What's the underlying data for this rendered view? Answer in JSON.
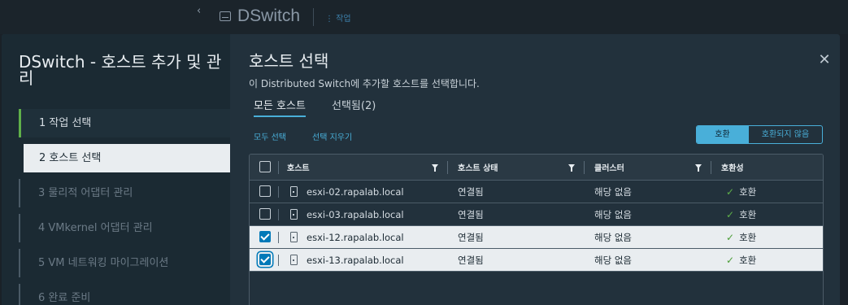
{
  "app": {
    "object_title": "DSwitch",
    "actions_label": "⋮ 작업",
    "collapse_glyph": "‹"
  },
  "wizard": {
    "title": "DSwitch - 호스트 추가 및 관리",
    "steps": [
      {
        "label": "1  작업 선택"
      },
      {
        "label": "2  호스트 선택"
      },
      {
        "label": "3  물리적 어댑터 관리"
      },
      {
        "label": "4  VMkernel 어댑터 관리"
      },
      {
        "label": "5  VM 네트워킹 마이그레이션"
      },
      {
        "label": "6  완료 준비"
      }
    ]
  },
  "page": {
    "title": "호스트 선택",
    "description": "이 Distributed Switch에 추가할 호스트를 선택합니다.",
    "close_glyph": "✕",
    "tabs": [
      {
        "label": "모든 호스트"
      },
      {
        "label": "선택됨(2)"
      }
    ],
    "select_all": "모두 선택",
    "clear_selection": "선택 지우기",
    "filter": {
      "compatible": "호환",
      "incompatible": "호환되지 않음"
    }
  },
  "grid": {
    "columns": [
      "호스트",
      "호스트 상태",
      "클러스터",
      "호환성"
    ],
    "rows": [
      {
        "host": "esxi-02.rapalab.local",
        "status": "연결됨",
        "cluster": "해당 없음",
        "compat": "호환",
        "selected": false
      },
      {
        "host": "esxi-03.rapalab.local",
        "status": "연결됨",
        "cluster": "해당 없음",
        "compat": "호환",
        "selected": false
      },
      {
        "host": "esxi-12.rapalab.local",
        "status": "연결됨",
        "cluster": "해당 없음",
        "compat": "호환",
        "selected": true
      },
      {
        "host": "esxi-13.rapalab.local",
        "status": "연결됨",
        "cluster": "해당 없음",
        "compat": "호환",
        "selected": true
      }
    ]
  },
  "colors": {
    "accent": "#49afd9",
    "success": "#5fb04a",
    "modal_bg": "#22313c",
    "sidebar_bg": "#1b2a33"
  }
}
